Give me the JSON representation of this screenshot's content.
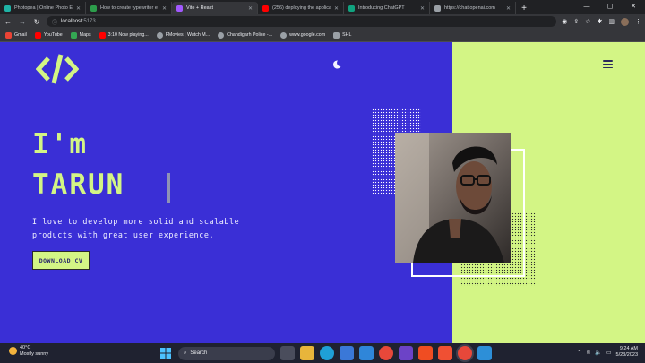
{
  "browser": {
    "tabs": [
      {
        "label": "Photopea | Online Photo Ed",
        "favicon_color": "#1fb3a6",
        "active": false
      },
      {
        "label": "How to create typewriter e",
        "favicon_color": "#2c9d4b",
        "active": false
      },
      {
        "label": "Vite + React",
        "favicon_color": "#a259ff",
        "active": true
      },
      {
        "label": "(256) deploying the applica",
        "favicon_color": "#ff0000",
        "active": false
      },
      {
        "label": "Introducing ChatGPT",
        "favicon_color": "#10a37f",
        "active": false
      },
      {
        "label": "https://chat.openai.com",
        "favicon_color": "#9aa0a6",
        "active": false
      }
    ],
    "address": {
      "host": "localhost",
      "port": ":5173"
    },
    "bookmarks": [
      {
        "label": "Gmail",
        "color": "#ea4335"
      },
      {
        "label": "YouTube",
        "color": "#ff0000"
      },
      {
        "label": "Maps",
        "color": "#34a853"
      },
      {
        "label": "3:10 Now playing...",
        "color": "#ff0000"
      },
      {
        "label": "FMovies | Watch M...",
        "color": "#9aa0a6"
      },
      {
        "label": "Chandigarh Police -...",
        "color": "#9aa0a6"
      },
      {
        "label": "www.google.com",
        "color": "#9aa0a6"
      },
      {
        "label": "SHL",
        "color": "#9aa0a6"
      }
    ]
  },
  "page": {
    "colors": {
      "primary": "#3a2fd6",
      "accent": "#d3f585"
    },
    "logo_icon": "code-brackets-icon",
    "theme_icon": "moon-icon",
    "menu_icon": "hamburger-icon",
    "hero": {
      "line1": "I'm",
      "line2": "TARUN",
      "tagline_1": "I love to develop more solid and scalable",
      "tagline_2": "products with great user experience.",
      "cta": "DOWNLOAD CV"
    }
  },
  "taskbar": {
    "weather_temp": "40°C",
    "weather_desc": "Mostly sunny",
    "search_label": "Search",
    "time": "9:24 AM",
    "date": "5/23/2023"
  }
}
